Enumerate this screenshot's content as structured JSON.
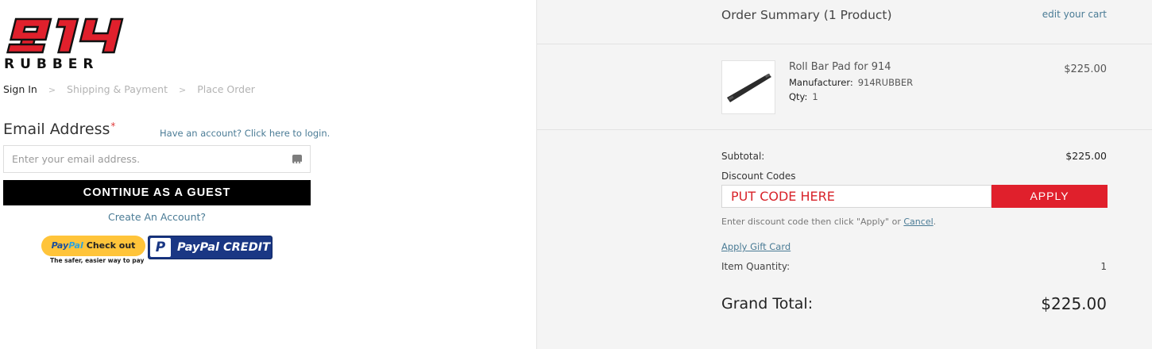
{
  "brand": {
    "logo_number": "914",
    "logo_word": "RUBBER"
  },
  "breadcrumb": {
    "step1": "Sign In",
    "step2": "Shipping & Payment",
    "step3": "Place Order",
    "separator": ">"
  },
  "login": {
    "email_label": "Email Address",
    "required_mark": "*",
    "have_account_link": "Have an account? Click here to login.",
    "email_placeholder": "Enter your email address.",
    "guest_button": "CONTINUE AS A GUEST",
    "create_account_link": "Create An Account?"
  },
  "paypal": {
    "checkout_pay": "Pay",
    "checkout_pal": "Pal",
    "checkout_label": "Check out",
    "tagline": "The safer, easier way to pay",
    "credit_badge": "P",
    "credit_label": "PayPal CREDIT"
  },
  "summary": {
    "title": "Order Summary (1 Product)",
    "edit_cart": "edit your cart",
    "product": {
      "name": "Roll Bar Pad for 914",
      "manufacturer_label": "Manufacturer:",
      "manufacturer": "914RUBBER",
      "qty_label": "Qty:",
      "qty": "1",
      "price": "$225.00"
    },
    "subtotal_label": "Subtotal:",
    "subtotal_value": "$225.00",
    "discount_label": "Discount Codes",
    "discount_placeholder": "PUT CODE HERE",
    "apply_button": "APPLY",
    "discount_help": "Enter discount code then click \"Apply\" or",
    "cancel_link": "Cancel",
    "help_period": ".",
    "gift_card_link": "Apply Gift Card",
    "item_qty_label": "Item Quantity:",
    "item_qty_value": "1",
    "grand_total_label": "Grand Total:",
    "grand_total_value": "$225.00"
  },
  "colors": {
    "logo_red": "#e0202c",
    "apply_red": "#e0202c",
    "link_blue": "#4a7b95",
    "guest_black": "#000000",
    "summary_bg": "#f4f4f4"
  }
}
